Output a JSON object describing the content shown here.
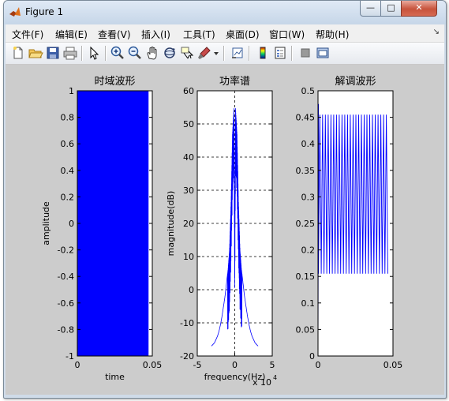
{
  "window": {
    "title": "Figure 1",
    "minimize": "—",
    "maximize": "□",
    "close": "✕"
  },
  "menu": [
    {
      "label": "文件(F)"
    },
    {
      "label": "编辑(E)"
    },
    {
      "label": "查看(V)"
    },
    {
      "label": "插入(I)"
    },
    {
      "label": "工具(T)"
    },
    {
      "label": "桌面(D)"
    },
    {
      "label": "窗口(W)"
    },
    {
      "label": "帮助(H)"
    }
  ],
  "menu_overflow": "↘",
  "toolbar": {
    "icons": [
      "new-figure-icon",
      "open-file-icon",
      "save-icon",
      "print-icon",
      "pointer-icon",
      "zoom-in-icon",
      "zoom-out-icon",
      "pan-icon",
      "rotate-3d-icon",
      "data-cursor-icon",
      "brush-icon",
      "dropdown-arrow-icon",
      "link-plot-icon",
      "colorbar-icon",
      "legend-icon",
      "hide-plot-tools-icon",
      "show-plot-tools-icon"
    ]
  },
  "colors": {
    "plot_line": "#0000ff",
    "figure_bg": "#cccccc",
    "axes_bg": "#ffffff"
  },
  "chart_data": [
    {
      "type": "area",
      "title": "时域波形",
      "xlabel": "time",
      "ylabel": "amplitude",
      "xlim": [
        0,
        0.05
      ],
      "ylim": [
        -1,
        1
      ],
      "xticks": [
        "0",
        "0.05"
      ],
      "yticks": [
        "1",
        "0.8",
        "0.6",
        "0.4",
        "0.2",
        "0",
        "-0.2",
        "-0.4",
        "-0.6",
        "-0.8",
        "-1"
      ],
      "ytick_values": [
        1,
        0.8,
        0.6,
        0.4,
        0.2,
        0,
        -0.2,
        -0.4,
        -0.6,
        -0.8,
        -1
      ],
      "grid": false,
      "series": [
        {
          "x_start": 0,
          "x_end": 0.0475,
          "ymin": -1,
          "ymax": 1
        }
      ]
    },
    {
      "type": "line",
      "title": "功率谱",
      "xlabel": "frequency(Hz)",
      "ylabel": "magnitude(dB)",
      "x_multiplier": "x 10",
      "x_multiplier_exp": "4",
      "xlim": [
        -5,
        5
      ],
      "ylim": [
        -20,
        60
      ],
      "xticks": [
        "-5",
        "0",
        "5"
      ],
      "xtick_values": [
        -5,
        0,
        5
      ],
      "yticks": [
        "60",
        "50",
        "40",
        "30",
        "20",
        "10",
        "0",
        "-10",
        "-20"
      ],
      "ytick_values": [
        60,
        50,
        40,
        30,
        20,
        10,
        0,
        -10,
        -20
      ],
      "grid": true,
      "series": [
        {
          "x": [
            -3.1,
            -2.9,
            -2.7,
            -2.5,
            -2.3,
            -2.1,
            -1.9,
            -1.7,
            -1.5,
            -1.3,
            -1.1,
            -0.9,
            -0.7,
            -0.5,
            -0.3,
            -0.1,
            0,
            0.1,
            0.3,
            0.5,
            0.7,
            0.9,
            1.1,
            1.3,
            1.5,
            1.7,
            1.9,
            2.1,
            2.3,
            2.5,
            2.7,
            2.9,
            3.1
          ],
          "y": [
            -17,
            -16.5,
            -16,
            -15,
            -14,
            -12.5,
            -10.5,
            -8,
            -5,
            -2,
            2,
            6,
            12,
            26,
            47,
            55,
            15,
            55,
            47,
            26,
            12,
            6,
            2,
            -2,
            -5,
            -8,
            -10.5,
            -12.5,
            -14,
            -15,
            -16,
            -16.5,
            -17
          ]
        }
      ]
    },
    {
      "type": "line",
      "title": "解调波形",
      "xlabel": "",
      "ylabel": "",
      "xlim": [
        0,
        0.05
      ],
      "ylim": [
        0,
        0.5
      ],
      "xticks": [
        "0",
        "0.05"
      ],
      "yticks": [
        "0.5",
        "0.45",
        "0.4",
        "0.35",
        "0.3",
        "0.25",
        "0.2",
        "0.15",
        "0.1",
        "0.05",
        "0"
      ],
      "ytick_values": [
        0.5,
        0.45,
        0.4,
        0.35,
        0.3,
        0.25,
        0.2,
        0.15,
        0.1,
        0.05,
        0
      ],
      "grid": false,
      "series": [
        {
          "x_start": 0.0003,
          "x_end": 0.0465,
          "low": 0.155,
          "high": 0.455,
          "cycles": 25,
          "initial_peak": 0.475
        }
      ]
    }
  ]
}
